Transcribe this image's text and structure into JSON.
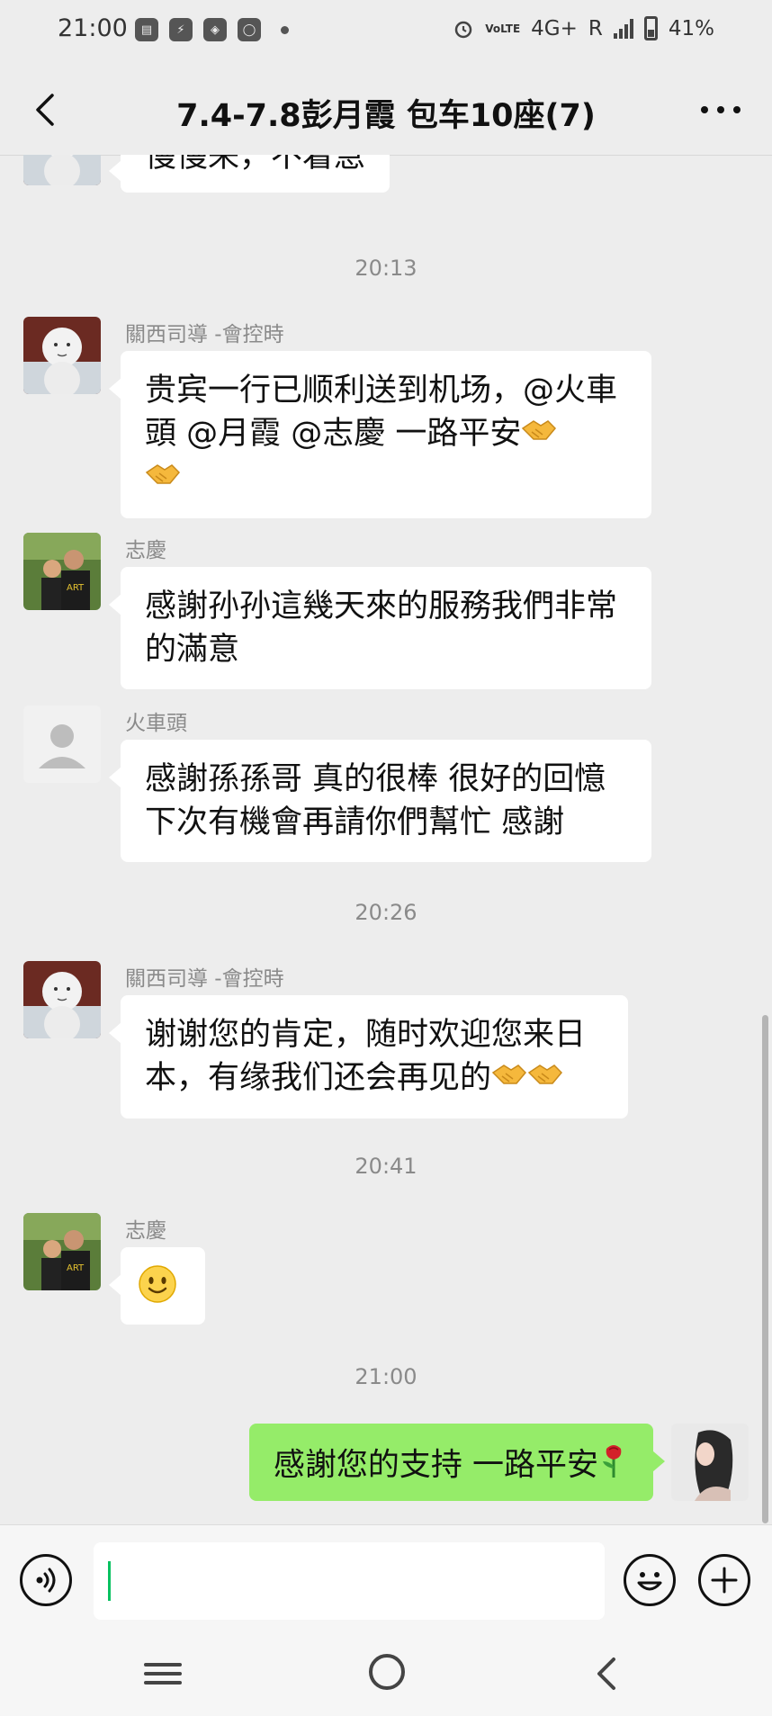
{
  "status_bar": {
    "time": "21:00",
    "network": "4G+",
    "volte": "VoLTE",
    "roaming": "R",
    "battery": "41%",
    "app_icons": [
      "message-icon",
      "messenger-icon",
      "app-icon",
      "line-icon"
    ]
  },
  "header": {
    "title": "7.4-7.8彭月霞 包车10座(7)",
    "back_icon": "chevron-left-icon",
    "more_icon": "more-horizontal-icon"
  },
  "messages": [
    {
      "type": "text",
      "sender": "",
      "avatar": "snowman",
      "text": "慢慢来，不着急"
    },
    {
      "type": "time",
      "text": "20:13"
    },
    {
      "type": "text",
      "sender": "關西司導 -會控時",
      "avatar": "snowman",
      "lines": [
        "贵宾一行已顺利送到机场，@火車",
        "頭  @月霞  @志慶   一路平安"
      ]
    },
    {
      "type": "text",
      "sender": "志慶",
      "avatar": "couple",
      "lines": [
        "感謝孙孙這幾天來的服務我們非常",
        "的滿意"
      ]
    },
    {
      "type": "text",
      "sender": "火車頭",
      "avatar": "default",
      "lines": [
        "感謝孫孫哥 真的很棒 很好的回憶",
        "下次有機會再請你們幫忙 感謝"
      ]
    },
    {
      "type": "time",
      "text": "20:26"
    },
    {
      "type": "text",
      "sender": "關西司導 -會控時",
      "avatar": "snowman",
      "lines": [
        "谢谢您的肯定，随时欢迎您来日",
        "本，有缘我们还会再见的"
      ]
    },
    {
      "type": "time",
      "text": "20:41"
    },
    {
      "type": "emoji",
      "sender": "志慶",
      "avatar": "couple",
      "emoji": "smile-emoji"
    },
    {
      "type": "time",
      "text": "21:00"
    },
    {
      "type": "self",
      "text": "感謝您的支持 一路平安"
    }
  ],
  "input_bar": {
    "text_value": "",
    "voice_icon": "voice-icon",
    "emoji_icon": "emoji-icon",
    "plus_icon": "plus-icon"
  },
  "colors": {
    "background": "#ededed",
    "self_bubble": "#95ec69",
    "other_bubble": "#ffffff",
    "accent": "#07c160"
  }
}
